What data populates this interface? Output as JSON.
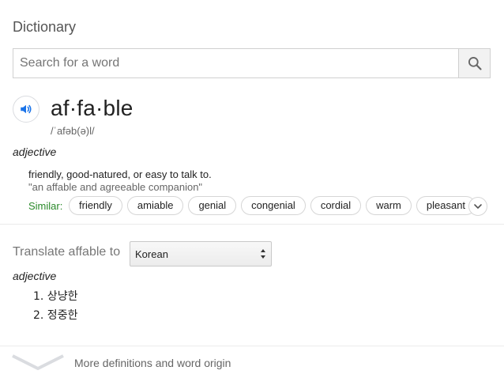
{
  "header": {
    "title": "Dictionary"
  },
  "search": {
    "placeholder": "Search for a word",
    "value": "",
    "icon": "search-icon"
  },
  "entry": {
    "word": "af·fa·ble",
    "phonetic": "/ˈafəb(ə)l/",
    "audio_icon": "speaker-icon",
    "part_of_speech": "adjective",
    "definition": "friendly, good-natured, or easy to talk to.",
    "example": "\"an affable and agreeable companion\"",
    "similar_label": "Similar:",
    "similar": [
      "friendly",
      "amiable",
      "genial",
      "congenial",
      "cordial",
      "warm",
      "pleasant"
    ]
  },
  "translate": {
    "label": "Translate affable to",
    "language": "Korean",
    "part_of_speech": "adjective",
    "items": [
      "1. 상냥한",
      "2. 정중한"
    ]
  },
  "footer": {
    "more_label": "More definitions and word origin"
  },
  "colors": {
    "accent_blue": "#1a73e8",
    "similar_green": "#2a8a2a"
  }
}
